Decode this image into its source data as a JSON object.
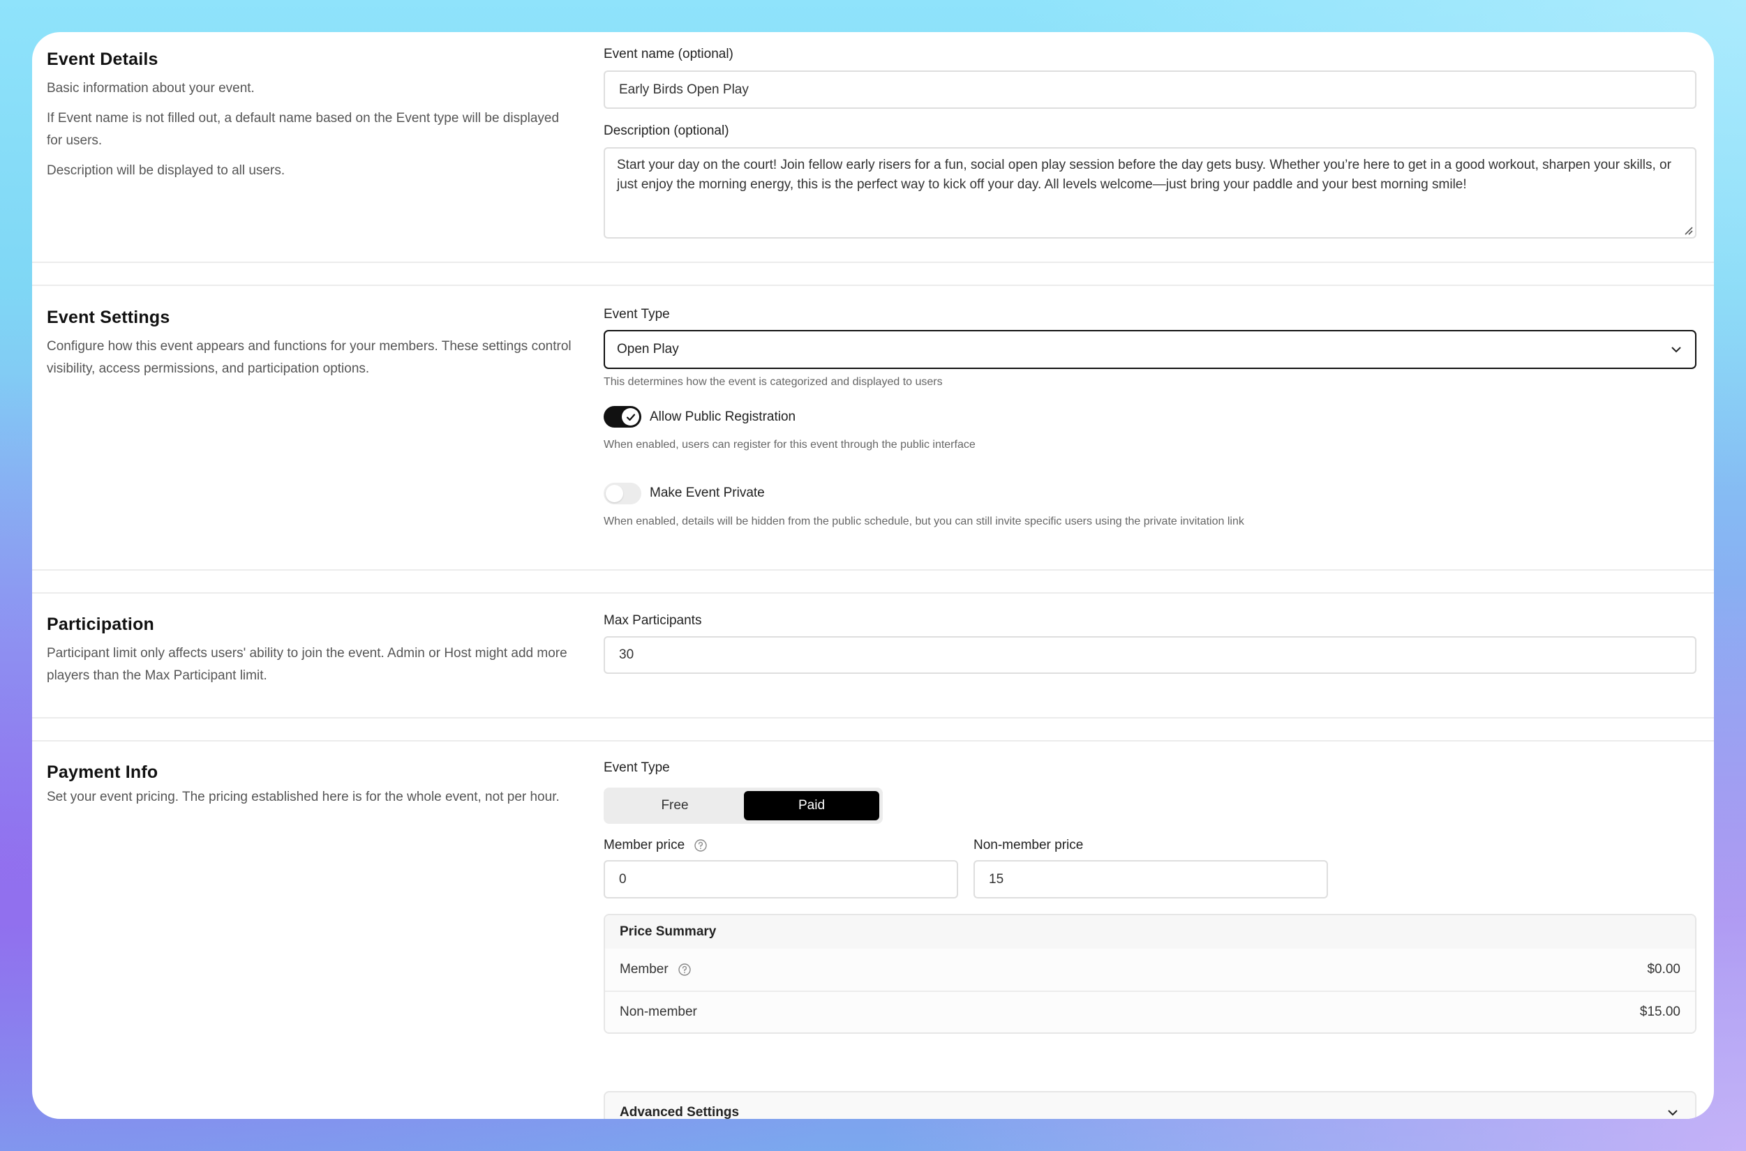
{
  "event_details": {
    "title": "Event Details",
    "desc1": "Basic information about your event.",
    "desc2": "If Event name is not filled out, a default name based on the Event type will be displayed for users.",
    "desc3": "Description will be displayed to all users.",
    "name_label": "Event name (optional)",
    "name_value": "Early Birds Open Play",
    "description_label": "Description (optional)",
    "description_value": "Start your day on the court! Join fellow early risers for a fun, social open play session before the day gets busy. Whether you’re here to get in a good workout, sharpen your skills, or just enjoy the morning energy, this is the perfect way to kick off your day. All levels welcome—just bring your paddle and your best morning smile!"
  },
  "event_settings": {
    "title": "Event Settings",
    "desc": "Configure how this event appears and functions for your members. These settings control visibility, access permissions, and participation options.",
    "type_label": "Event Type",
    "type_value": "Open Play",
    "type_hint": "This determines how the event is categorized and displayed to users",
    "public_reg_label": "Allow Public Registration",
    "public_reg_on": true,
    "public_reg_hint": "When enabled, users can register for this event through the public interface",
    "private_label": "Make Event Private",
    "private_on": false,
    "private_hint": "When enabled, details will be hidden from the public schedule, but you can still invite specific users using the private invitation link"
  },
  "participation": {
    "title": "Participation",
    "desc": "Participant limit only affects users' ability to join the event. Admin or Host might add more players than the Max Participant limit.",
    "max_label": "Max Participants",
    "max_value": "30"
  },
  "payment": {
    "title": "Payment Info",
    "desc": "Set your event pricing. The pricing established here is for the whole event, not per hour.",
    "type_label": "Event Type",
    "option_free": "Free",
    "option_paid": "Paid",
    "selected": "Paid",
    "member_price_label": "Member price",
    "member_price_value": "0",
    "nonmember_price_label": "Non-member price",
    "nonmember_price_value": "15",
    "summary": {
      "title": "Price Summary",
      "member_label": "Member",
      "member_value": "$0.00",
      "nonmember_label": "Non-member",
      "nonmember_value": "$15.00"
    },
    "advanced_label": "Advanced Settings"
  },
  "colors": {
    "accent": "#111111",
    "border": "#dedede",
    "muted_text": "#555555"
  }
}
